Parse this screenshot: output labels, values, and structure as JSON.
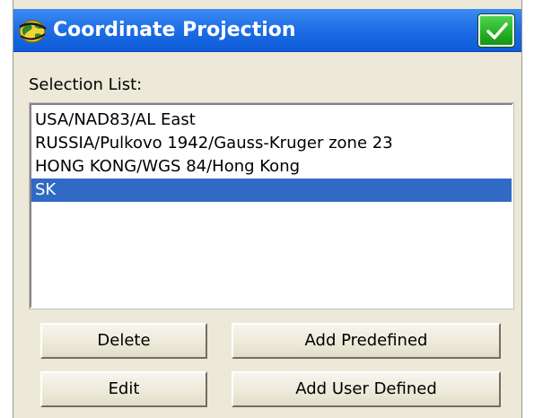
{
  "window": {
    "title": "Coordinate Projection",
    "ok_icon": "checkmark-icon",
    "app_icon": "globe-icon"
  },
  "selection": {
    "label": "Selection List:",
    "items": [
      {
        "label": "USA/NAD83/AL East",
        "selected": false
      },
      {
        "label": "RUSSIA/Pulkovo 1942/Gauss-Kruger zone 23",
        "selected": false
      },
      {
        "label": "HONG KONG/WGS 84/Hong Kong",
        "selected": false
      },
      {
        "label": "SK",
        "selected": true
      }
    ]
  },
  "buttons": {
    "delete": "Delete",
    "edit": "Edit",
    "add_predefined": "Add Predefined",
    "add_user_defined": "Add User Defined"
  },
  "colors": {
    "title_bar": "#0d5bd8",
    "selection_highlight": "#316ac5",
    "ok_button": "#24b024",
    "dialog_background": "#ece9d8"
  }
}
